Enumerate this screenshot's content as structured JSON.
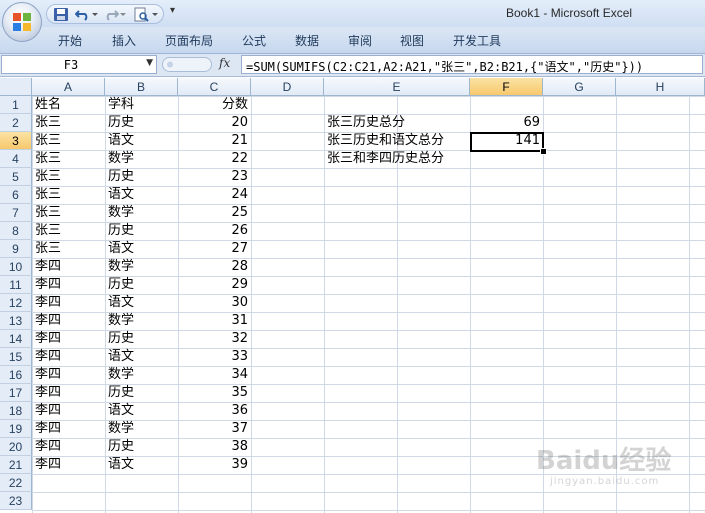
{
  "window": {
    "title": "Book1 - Microsoft Excel"
  },
  "qat": {
    "more": "▾"
  },
  "ribbon": {
    "tabs": [
      "开始",
      "插入",
      "页面布局",
      "公式",
      "数据",
      "审阅",
      "视图",
      "开发工具"
    ]
  },
  "formula_bar": {
    "name_box": "F3",
    "fx": "fx",
    "formula": "=SUM(SUMIFS(C2:C21,A2:A21,\"张三\",B2:B21,{\"语文\",\"历史\"}))"
  },
  "sheet": {
    "columns": [
      "A",
      "B",
      "C",
      "D",
      "E",
      "F",
      "G",
      "H"
    ],
    "selected_column": "F",
    "selected_row": 3,
    "rows": [
      {
        "n": "1",
        "a": "姓名",
        "b": "学科",
        "c": "分数",
        "e": "",
        "f": ""
      },
      {
        "n": "2",
        "a": "张三",
        "b": "历史",
        "c": "20",
        "e": "张三历史总分",
        "f": "69"
      },
      {
        "n": "3",
        "a": "张三",
        "b": "语文",
        "c": "21",
        "e": "张三历史和语文总分",
        "f": "141"
      },
      {
        "n": "4",
        "a": "张三",
        "b": "数学",
        "c": "22",
        "e": "张三和李四历史总分",
        "f": ""
      },
      {
        "n": "5",
        "a": "张三",
        "b": "历史",
        "c": "23",
        "e": "",
        "f": ""
      },
      {
        "n": "6",
        "a": "张三",
        "b": "语文",
        "c": "24",
        "e": "",
        "f": ""
      },
      {
        "n": "7",
        "a": "张三",
        "b": "数学",
        "c": "25",
        "e": "",
        "f": ""
      },
      {
        "n": "8",
        "a": "张三",
        "b": "历史",
        "c": "26",
        "e": "",
        "f": ""
      },
      {
        "n": "9",
        "a": "张三",
        "b": "语文",
        "c": "27",
        "e": "",
        "f": ""
      },
      {
        "n": "10",
        "a": "李四",
        "b": "数学",
        "c": "28",
        "e": "",
        "f": ""
      },
      {
        "n": "11",
        "a": "李四",
        "b": "历史",
        "c": "29",
        "e": "",
        "f": ""
      },
      {
        "n": "12",
        "a": "李四",
        "b": "语文",
        "c": "30",
        "e": "",
        "f": ""
      },
      {
        "n": "13",
        "a": "李四",
        "b": "数学",
        "c": "31",
        "e": "",
        "f": ""
      },
      {
        "n": "14",
        "a": "李四",
        "b": "历史",
        "c": "32",
        "e": "",
        "f": ""
      },
      {
        "n": "15",
        "a": "李四",
        "b": "语文",
        "c": "33",
        "e": "",
        "f": ""
      },
      {
        "n": "16",
        "a": "李四",
        "b": "数学",
        "c": "34",
        "e": "",
        "f": ""
      },
      {
        "n": "17",
        "a": "李四",
        "b": "历史",
        "c": "35",
        "e": "",
        "f": ""
      },
      {
        "n": "18",
        "a": "李四",
        "b": "语文",
        "c": "36",
        "e": "",
        "f": ""
      },
      {
        "n": "19",
        "a": "李四",
        "b": "数学",
        "c": "37",
        "e": "",
        "f": ""
      },
      {
        "n": "20",
        "a": "李四",
        "b": "历史",
        "c": "38",
        "e": "",
        "f": ""
      },
      {
        "n": "21",
        "a": "李四",
        "b": "语文",
        "c": "39",
        "e": "",
        "f": ""
      },
      {
        "n": "22",
        "a": "",
        "b": "",
        "c": "",
        "e": "",
        "f": ""
      },
      {
        "n": "23",
        "a": "",
        "b": "",
        "c": "",
        "e": "",
        "f": ""
      }
    ]
  },
  "watermark": {
    "text": "Baidu经验",
    "sub": "jingyan.baidu.com"
  },
  "colors": {
    "title_bar": "#cfdef3",
    "ribbon": "#c6d7ee",
    "grid_line": "#d0d7e5",
    "selected_header": "#f7c86c",
    "header_text": "#27415f"
  }
}
